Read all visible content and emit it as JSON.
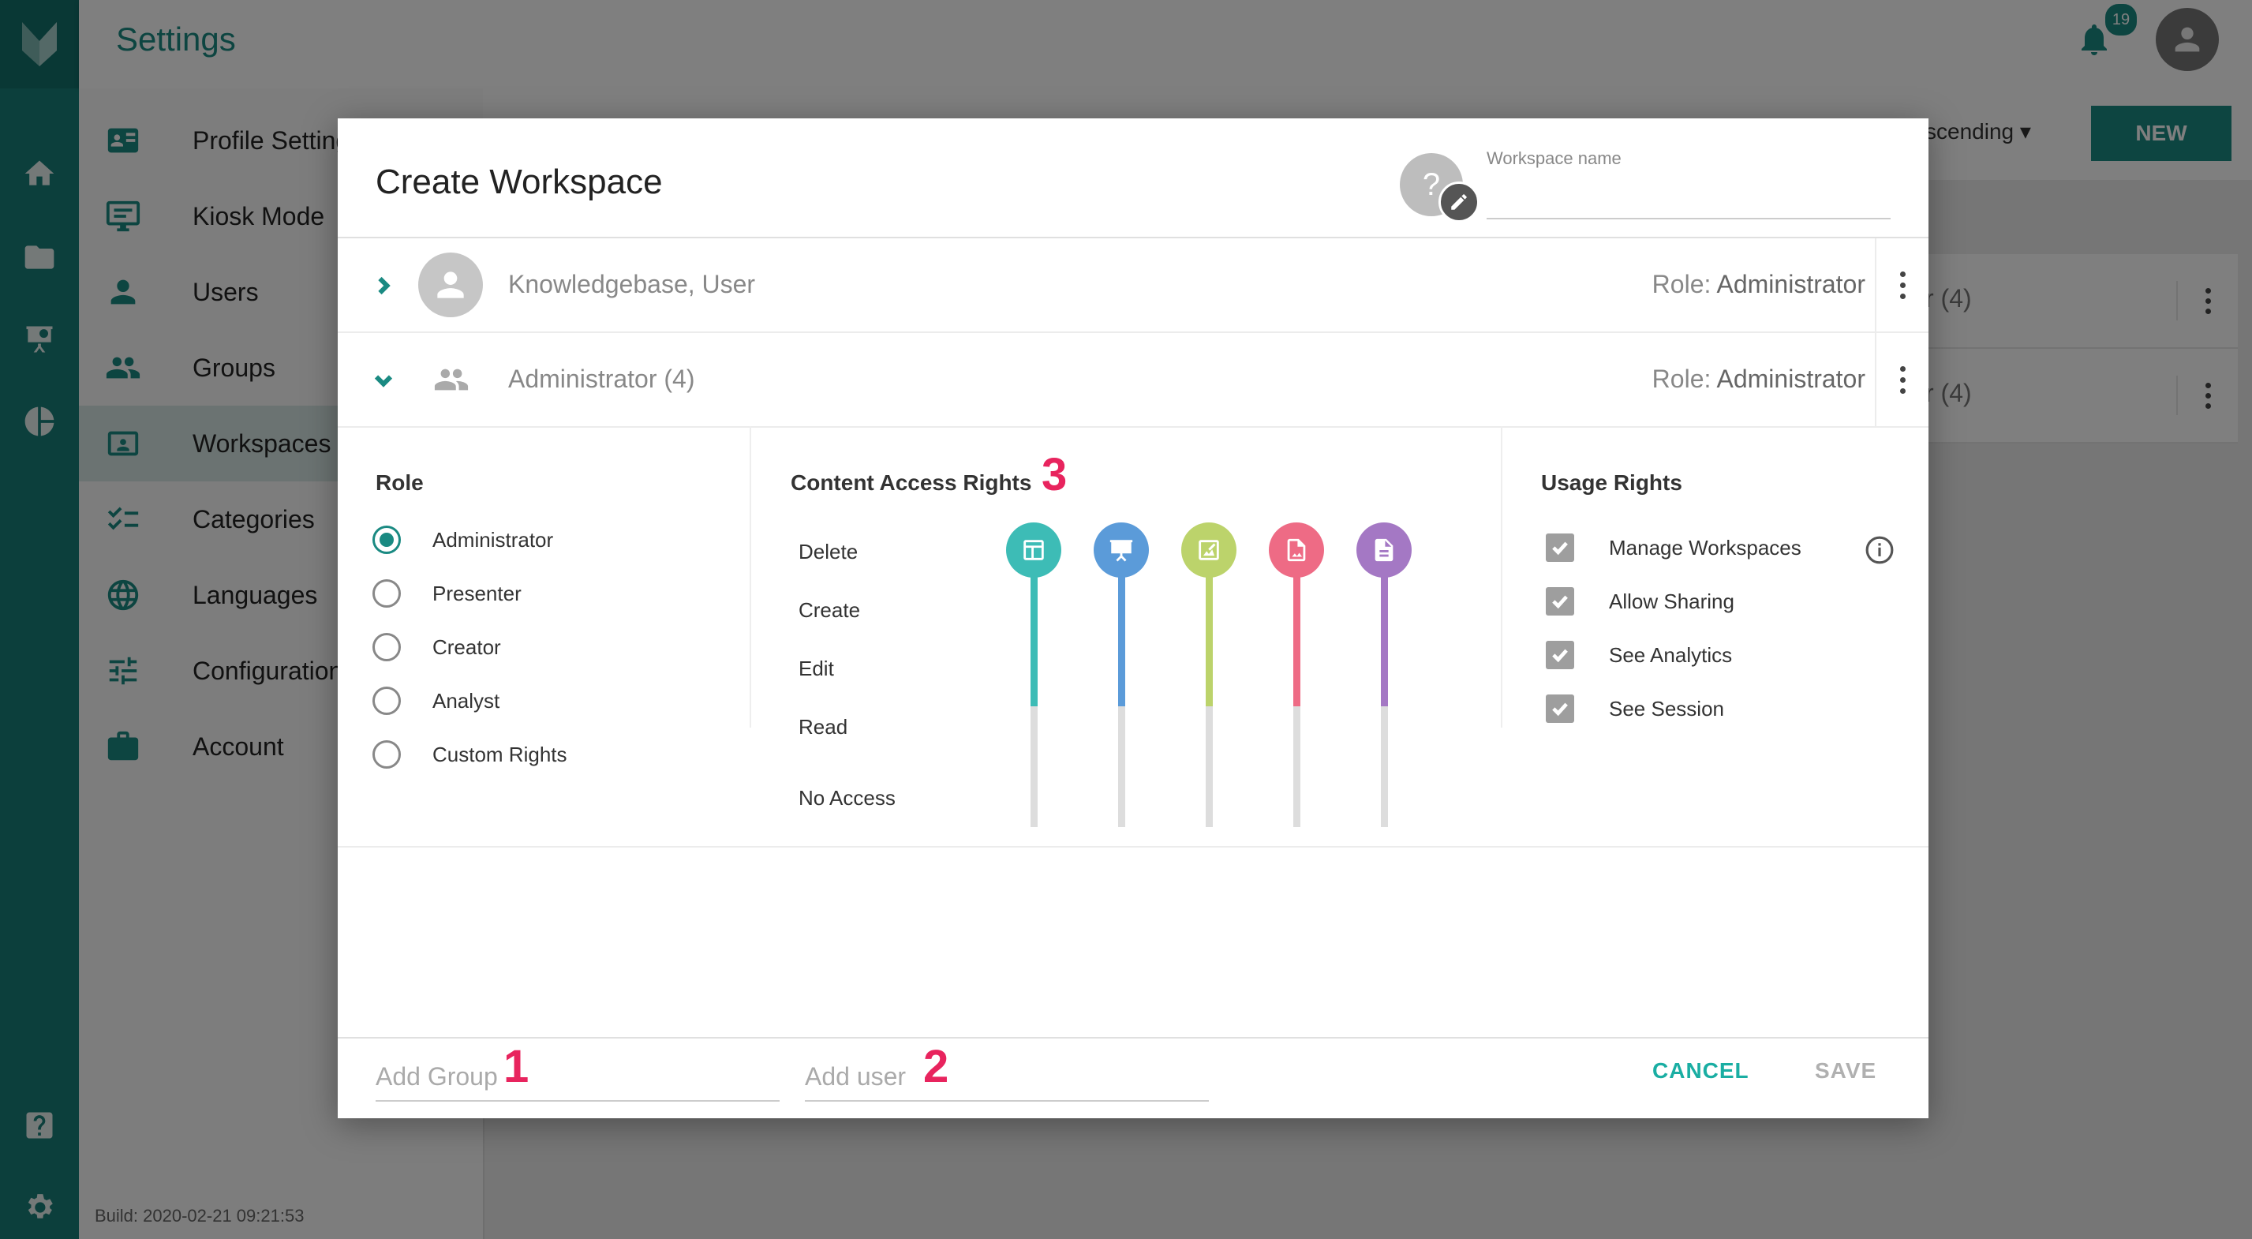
{
  "app": {
    "title": "Settings",
    "notification_count": "19",
    "build": "Build: 2020-02-21 09:21:53"
  },
  "rail": {
    "items": [
      "home-icon",
      "folder-icon",
      "presentation-icon",
      "analytics-icon",
      "help-icon",
      "settings-icon"
    ]
  },
  "settings_nav": {
    "items": [
      {
        "label": "Profile Settings",
        "icon": "profile-card-icon"
      },
      {
        "label": "Kiosk Mode",
        "icon": "monitor-icon"
      },
      {
        "label": "Users",
        "icon": "person-icon"
      },
      {
        "label": "Groups",
        "icon": "people-icon"
      },
      {
        "label": "Workspaces",
        "icon": "workspace-icon",
        "active": true
      },
      {
        "label": "Categories",
        "icon": "checklist-icon"
      },
      {
        "label": "Languages",
        "icon": "globe-icon"
      },
      {
        "label": "Configuration",
        "icon": "sliders-icon"
      },
      {
        "label": "Account",
        "icon": "briefcase-icon"
      }
    ]
  },
  "list_toolbar": {
    "sort_label": "scending",
    "new_label": "NEW"
  },
  "background_rows": [
    {
      "text": "r (4)"
    },
    {
      "text": "r (4)"
    }
  ],
  "dialog": {
    "title": "Create Workspace",
    "avatar_placeholder": "?",
    "workspace_name_label": "Workspace name",
    "workspace_name_value": "",
    "members": [
      {
        "name": "Knowledgebase, User",
        "role_prefix": "Role:",
        "role": "Administrator",
        "type": "user",
        "expanded": false
      },
      {
        "name": "Administrator (4)",
        "role_prefix": "Role:",
        "role": "Administrator",
        "type": "group",
        "expanded": true
      }
    ],
    "role_panel": {
      "title": "Role",
      "options": [
        "Administrator",
        "Presenter",
        "Creator",
        "Analyst",
        "Custom Rights"
      ],
      "selected": "Administrator"
    },
    "content_panel": {
      "title": "Content Access Rights",
      "levels": [
        "Delete",
        "Create",
        "Edit",
        "Read",
        "No Access"
      ],
      "sliders": [
        {
          "icon": "layout-icon",
          "color": "#3dbcb6",
          "level": "Read"
        },
        {
          "icon": "presentation-icon",
          "color": "#5b9bd9",
          "level": "Read"
        },
        {
          "icon": "image-edit-icon",
          "color": "#bcd36b",
          "level": "Read"
        },
        {
          "icon": "image-file-icon",
          "color": "#ee6b85",
          "level": "Read"
        },
        {
          "icon": "document-icon",
          "color": "#a478c4",
          "level": "Read"
        }
      ]
    },
    "usage_panel": {
      "title": "Usage Rights",
      "items": [
        {
          "label": "Manage Workspaces",
          "checked": true
        },
        {
          "label": "Allow Sharing",
          "checked": true
        },
        {
          "label": "See Analytics",
          "checked": true
        },
        {
          "label": "See Session",
          "checked": true
        }
      ]
    },
    "footer": {
      "add_group_placeholder": "Add Group",
      "add_user_placeholder": "Add user",
      "cancel_label": "CANCEL",
      "save_label": "SAVE"
    }
  },
  "annotations": [
    "1",
    "2",
    "3"
  ]
}
